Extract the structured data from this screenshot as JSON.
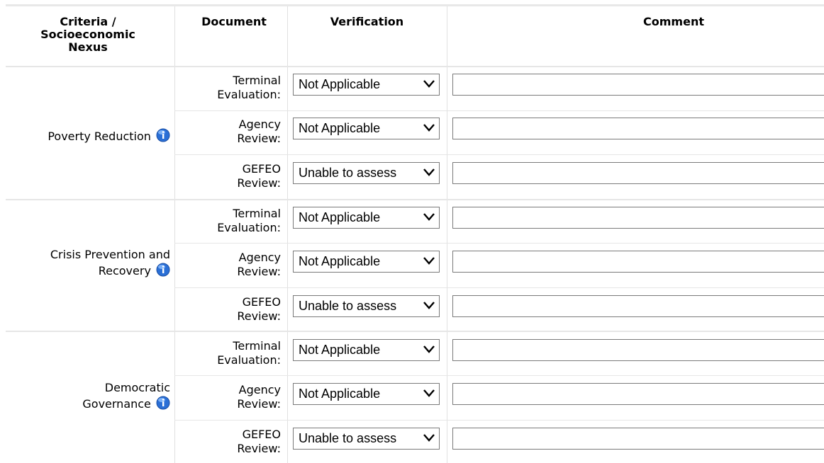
{
  "header": {
    "criteria_line1": "Criteria /",
    "criteria_line2": "Socioeconomic",
    "criteria_line3": "Nexus",
    "document": "Document",
    "verification": "Verification",
    "comment": "Comment"
  },
  "groups": [
    {
      "label_line1": "Poverty Reduction",
      "label_line2": "",
      "rows": [
        {
          "doc_line1": "Terminal",
          "doc_line2": "Evaluation:",
          "verification": "Not Applicable",
          "comment": ""
        },
        {
          "doc_line1": "Agency",
          "doc_line2": "Review:",
          "verification": "Not Applicable",
          "comment": ""
        },
        {
          "doc_line1": "GEFEO",
          "doc_line2": "Review:",
          "verification": "Unable to assess",
          "comment": ""
        }
      ]
    },
    {
      "label_line1": "Crisis Prevention and",
      "label_line2": "Recovery",
      "rows": [
        {
          "doc_line1": "Terminal",
          "doc_line2": "Evaluation:",
          "verification": "Not Applicable",
          "comment": ""
        },
        {
          "doc_line1": "Agency",
          "doc_line2": "Review:",
          "verification": "Not Applicable",
          "comment": ""
        },
        {
          "doc_line1": "GEFEO",
          "doc_line2": "Review:",
          "verification": "Unable to assess",
          "comment": ""
        }
      ]
    },
    {
      "label_line1": "Democratic",
      "label_line2": "Governance",
      "rows": [
        {
          "doc_line1": "Terminal",
          "doc_line2": "Evaluation:",
          "verification": "Not Applicable",
          "comment": ""
        },
        {
          "doc_line1": "Agency",
          "doc_line2": "Review:",
          "verification": "Not Applicable",
          "comment": ""
        },
        {
          "doc_line1": "GEFEO",
          "doc_line2": "Review:",
          "verification": "Unable to assess",
          "comment": ""
        }
      ]
    }
  ],
  "icons": {
    "info": "info-icon"
  },
  "colors": {
    "info_blue": "#2a6fd6",
    "border": "#7a7a7a",
    "separator": "#e6e6e6"
  }
}
